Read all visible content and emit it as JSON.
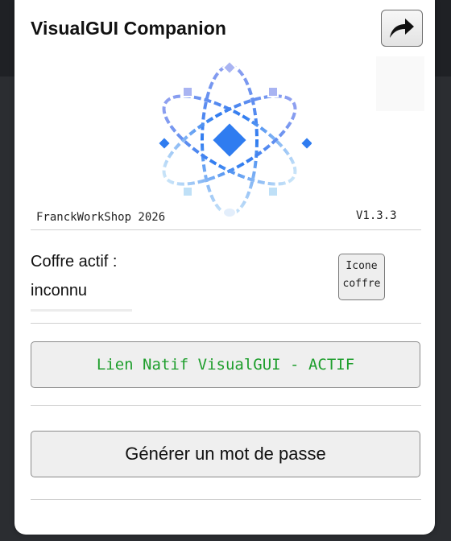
{
  "app": {
    "title": "VisualGUI Companion"
  },
  "header": {
    "share_icon": "share-arrow-icon"
  },
  "logo": {
    "icon": "atom-logo-icon",
    "colors": {
      "top": "#8fa0f0",
      "mid": "#2f7cf0",
      "bottom": "#b9dcf6"
    }
  },
  "footer": {
    "brand": "FranckWorkShop 2026",
    "version": "V1.3.3"
  },
  "vault": {
    "label": "Coffre actif :",
    "value": "inconnu",
    "icon_button_line1": "Icone",
    "icon_button_line2": "coffre"
  },
  "actions": {
    "native_link_label": "Lien Natif VisualGUI - ACTIF",
    "native_link_color": "#1e9e2c",
    "generate_password_label": "Générer un mot de passe"
  }
}
